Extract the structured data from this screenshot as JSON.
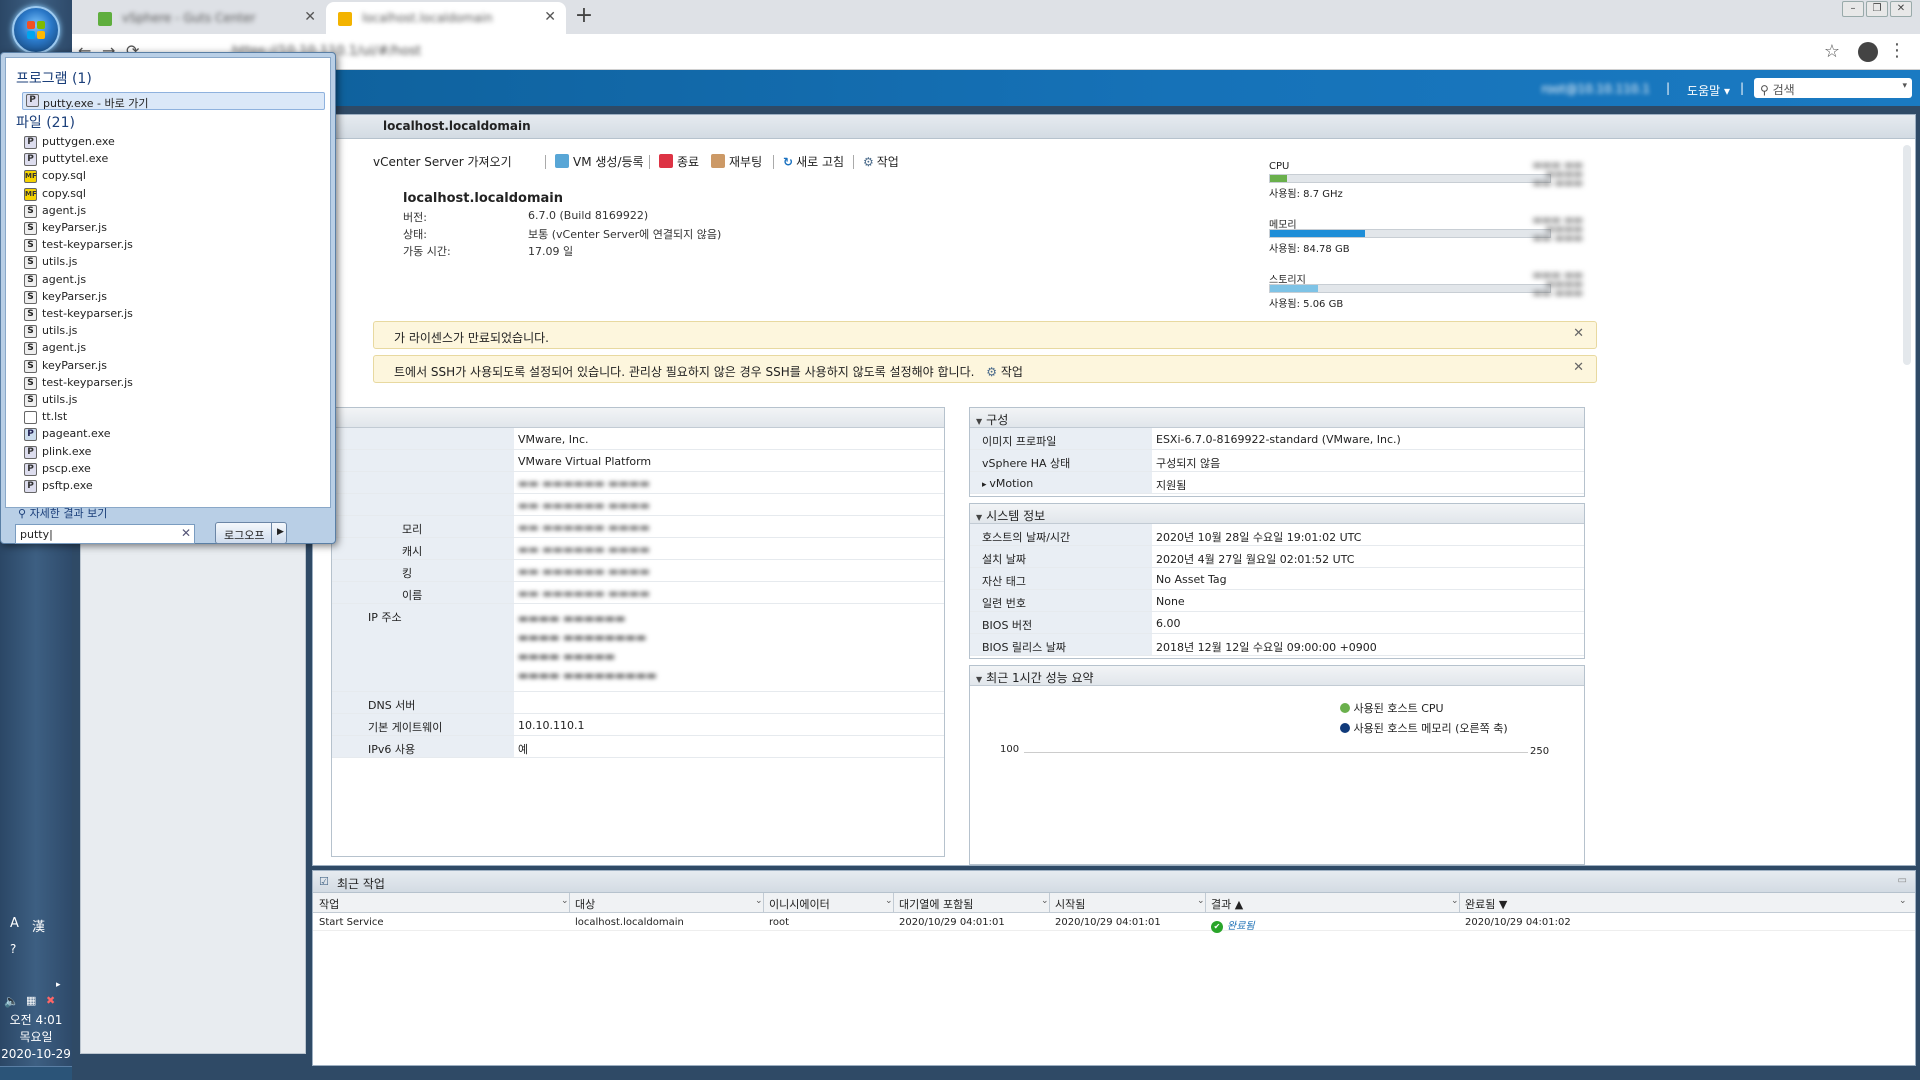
{
  "taskbar": {
    "clock_time": "오전 4:01",
    "clock_day": "목요일",
    "clock_date": "2020-10-29",
    "ime_a": "A",
    "ime_han": "漢"
  },
  "browser": {
    "tabs": [
      {
        "label": "vSphere - Guts Center",
        "active": false,
        "favicon_color": "#5fae3e"
      },
      {
        "label": "localhost.localdomain",
        "active": true,
        "favicon_color": "#f3b300"
      }
    ],
    "new_tab_glyph": "+",
    "omnibox_text": "https://10.10.110.1/ui/#/host"
  },
  "vsphere": {
    "header_user": "root@10.10.110.1",
    "help_label": "도움말",
    "search_placeholder": "검색",
    "main_title": "localhost.localdomain",
    "actions": {
      "get_vcenter": "vCenter Server 가져오기",
      "vm_create": "VM 생성/등록",
      "shutdown": "종료",
      "reboot": "재부팅",
      "refresh": "새로 고침",
      "task": "작업"
    },
    "host": {
      "name": "localhost.localdomain",
      "version_label": "버전:",
      "version_value": "6.7.0 (Build 8169922)",
      "state_label": "상태:",
      "state_value": "보통 (vCenter Server에 연결되지 않음)",
      "uptime_label": "가동 시간:",
      "uptime_value": "17.09 일"
    },
    "resources": {
      "cpu_label": "CPU",
      "cpu_used": "사용됨: 8.7 GHz",
      "cpu_fraction": 0.06,
      "memory_label": "메모리",
      "memory_used": "사용됨: 84.78 GB",
      "memory_fraction": 0.34,
      "storage_label": "스토리지",
      "storage_used": "사용됨: 5.06 GB",
      "storage_fraction": 0.17,
      "colors": {
        "cpu": "#6ab04c",
        "memory": "#1e8ed8",
        "storage": "#7ec3e6"
      }
    },
    "alerts": {
      "license": "가 라이센스가 만료되었습니다.",
      "ssh": "트에서 SSH가 사용되도록 설정되어 있습니다. 관리상 필요하지 않은 경우 SSH를 사용하지 않도록 설정해야 합니다.",
      "ssh_action": "작업"
    },
    "hardware": {
      "rows": [
        {
          "label": "",
          "value": "VMware, Inc."
        },
        {
          "label": "",
          "value": "VMware Virtual Platform"
        },
        {
          "label": "",
          "value": ""
        },
        {
          "label": "",
          "value": ""
        },
        {
          "label": "모리",
          "value": ""
        },
        {
          "label": "캐시",
          "value": ""
        },
        {
          "label": "킹",
          "value": ""
        },
        {
          "label": "이름",
          "value": ""
        }
      ],
      "ip_label": "IP 주소",
      "dns_label": "DNS 서버",
      "gateway_label": "기본 게이트웨이",
      "gateway_value": "10.10.110.1",
      "ipv6_label": "IPv6 사용",
      "ipv6_value": "예"
    },
    "config": {
      "title": "구성",
      "rows": [
        {
          "label": "이미지 프로파일",
          "value": "ESXi-6.7.0-8169922-standard (VMware, Inc.)"
        },
        {
          "label": "vSphere HA 상태",
          "value": "구성되지 않음"
        },
        {
          "label": "vMotion",
          "value": "지원됨"
        }
      ]
    },
    "sysinfo": {
      "title": "시스템 정보",
      "rows": [
        {
          "label": "호스트의 날짜/시간",
          "value": "2020년 10월 28일 수요일 19:01:02 UTC"
        },
        {
          "label": "설치 날짜",
          "value": "2020년 4월 27일 월요일 02:01:52 UTC"
        },
        {
          "label": "자산 태그",
          "value": "No Asset Tag"
        },
        {
          "label": "일련 번호",
          "value": "None"
        },
        {
          "label": "BIOS 버전",
          "value": "6.00"
        },
        {
          "label": "BIOS 릴리스 날짜",
          "value": "2018년 12월 12일 수요일 09:00:00 +0900"
        }
      ]
    },
    "perf": {
      "title": "최근 1시간 성능 요약",
      "legend_cpu": "사용된 호스트 CPU",
      "legend_mem": "사용된 호스트 메모리 (오른쪽 축)",
      "y_left_top": "100",
      "y_right_top": "250"
    },
    "tasks": {
      "title": "최근 작업",
      "columns": [
        "작업",
        "대상",
        "이니시에이터",
        "대기열에 포함됨",
        "시작됨",
        "결과 ▲",
        "완료됨 ▼"
      ],
      "rows": [
        {
          "task": "Start Service",
          "target": "localhost.localdomain",
          "initiator": "root",
          "queued": "2020/10/29 04:01:01",
          "started": "2020/10/29 04:01:01",
          "result": "완료됨",
          "completed": "2020/10/29 04:01:02"
        }
      ]
    }
  },
  "start_menu": {
    "programs_header": "프로그램 (1)",
    "program_item": "putty.exe - 바로 가기",
    "files_header": "파일 (21)",
    "files": [
      {
        "name": "puttygen.exe",
        "icon": "putty-icon"
      },
      {
        "name": "puttytel.exe",
        "icon": "putty-icon"
      },
      {
        "name": "copy.sql",
        "icon": "sql-icon"
      },
      {
        "name": "copy.sql",
        "icon": "sql-icon"
      },
      {
        "name": "agent.js",
        "icon": "js-icon"
      },
      {
        "name": "keyParser.js",
        "icon": "js-icon"
      },
      {
        "name": "test-keyparser.js",
        "icon": "js-icon"
      },
      {
        "name": "utils.js",
        "icon": "js-icon"
      },
      {
        "name": "agent.js",
        "icon": "js-icon"
      },
      {
        "name": "keyParser.js",
        "icon": "js-icon"
      },
      {
        "name": "test-keyparser.js",
        "icon": "js-icon"
      },
      {
        "name": "utils.js",
        "icon": "js-icon"
      },
      {
        "name": "agent.js",
        "icon": "js-icon"
      },
      {
        "name": "keyParser.js",
        "icon": "js-icon"
      },
      {
        "name": "test-keyparser.js",
        "icon": "js-icon"
      },
      {
        "name": "utils.js",
        "icon": "js-icon"
      },
      {
        "name": "tt.lst",
        "icon": "file-icon"
      },
      {
        "name": "pageant.exe",
        "icon": "pageant-icon"
      },
      {
        "name": "plink.exe",
        "icon": "putty-icon"
      },
      {
        "name": "pscp.exe",
        "icon": "putty-icon"
      },
      {
        "name": "psftp.exe",
        "icon": "putty-icon"
      }
    ],
    "more_results": "자세한 결과 보기",
    "search_value": "putty",
    "logoff_label": "로그오프"
  }
}
